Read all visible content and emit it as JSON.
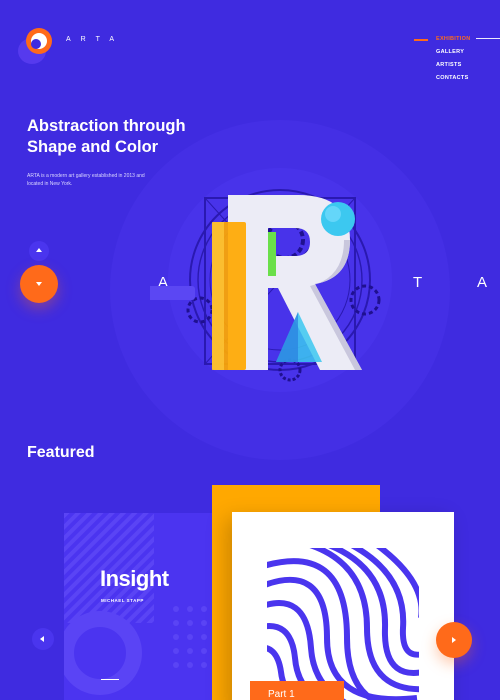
{
  "brand": {
    "name": "ARTA"
  },
  "nav": {
    "items": [
      {
        "label": "EXHIBITION",
        "active": true
      },
      {
        "label": "GALLERY",
        "active": false
      },
      {
        "label": "ARTISTS",
        "active": false
      },
      {
        "label": "CONTACTS",
        "active": false
      }
    ]
  },
  "hero": {
    "title": "Abstraction through Shape and Color",
    "description": "ARTA is a modern art gallery established in 2013 and located in New York.",
    "letters": [
      "A",
      "T",
      "A"
    ],
    "centerpiece_letter": "R",
    "icons": {
      "up": "arrow-up-icon",
      "down": "arrow-down-icon"
    }
  },
  "featured": {
    "title": "Featured",
    "cards": [
      {
        "title": "Insight",
        "author": "MICHAEL STAPP"
      },
      {
        "part_label": "Part 1"
      }
    ],
    "icons": {
      "prev": "arrow-left-icon",
      "next": "arrow-right-icon"
    }
  },
  "colors": {
    "background": "#3f2be0",
    "accent": "#ff6a1a",
    "yellow": "#ffa800",
    "cyan": "#3cc8f0"
  }
}
